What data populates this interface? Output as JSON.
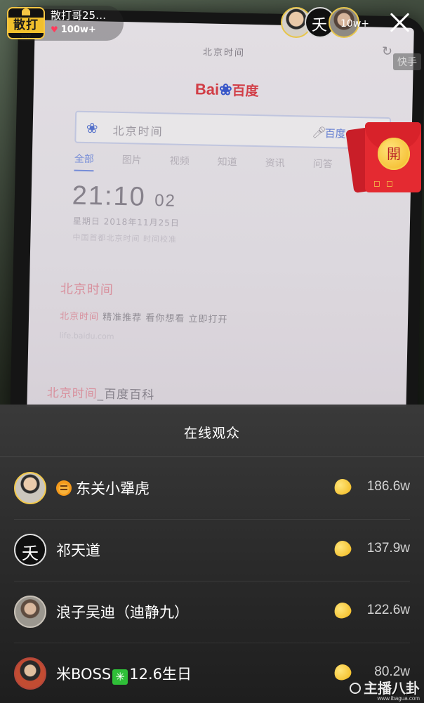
{
  "stream": {
    "anchor_badge": "散打哥",
    "anchor_name": "散打哥25…",
    "likes": "100w+",
    "viewer_count": "10w+",
    "platform_tag": "快手",
    "red_envelope_label": "開"
  },
  "phone_screen": {
    "url_text": "北京时间",
    "logo_bai": "Bai",
    "logo_du": "du",
    "logo_zh": "百度",
    "search_query": "北京时间",
    "search_button": "百度一下",
    "tabs": [
      "全部",
      "图片",
      "视频",
      "知道",
      "资讯",
      "问答"
    ],
    "clock_main": "21:10",
    "clock_sec": "02",
    "date_line": "星期日 2018年11月25日",
    "source_line": "中国首都北京时间 时间校准",
    "result1_title": "北京时间",
    "result1_highlight": "北京时间",
    "result1_text": " 精准推荐 看你想看 立即打开",
    "result1_url": "life.baidu.com",
    "result2_title": "北京时间",
    "result2_suffix": "_百度百科"
  },
  "sheet": {
    "title": "在线观众",
    "viewers": [
      {
        "name": "东关小犟虎",
        "score": "186.6w"
      },
      {
        "name": "祁天道",
        "score": "137.9w"
      },
      {
        "name": "浪子吴迪（迪静九）",
        "score": "122.6w"
      },
      {
        "name_prefix": "米BOSS",
        "name_suffix": "12.6生日",
        "score": "80.2w"
      }
    ]
  },
  "watermark": {
    "text": "主播八卦",
    "url": "www.ibagua.com"
  },
  "colors": {
    "accent_red": "#e42a31",
    "gold": "#f2b81c",
    "sheet_bg": "#2e2e2e"
  }
}
